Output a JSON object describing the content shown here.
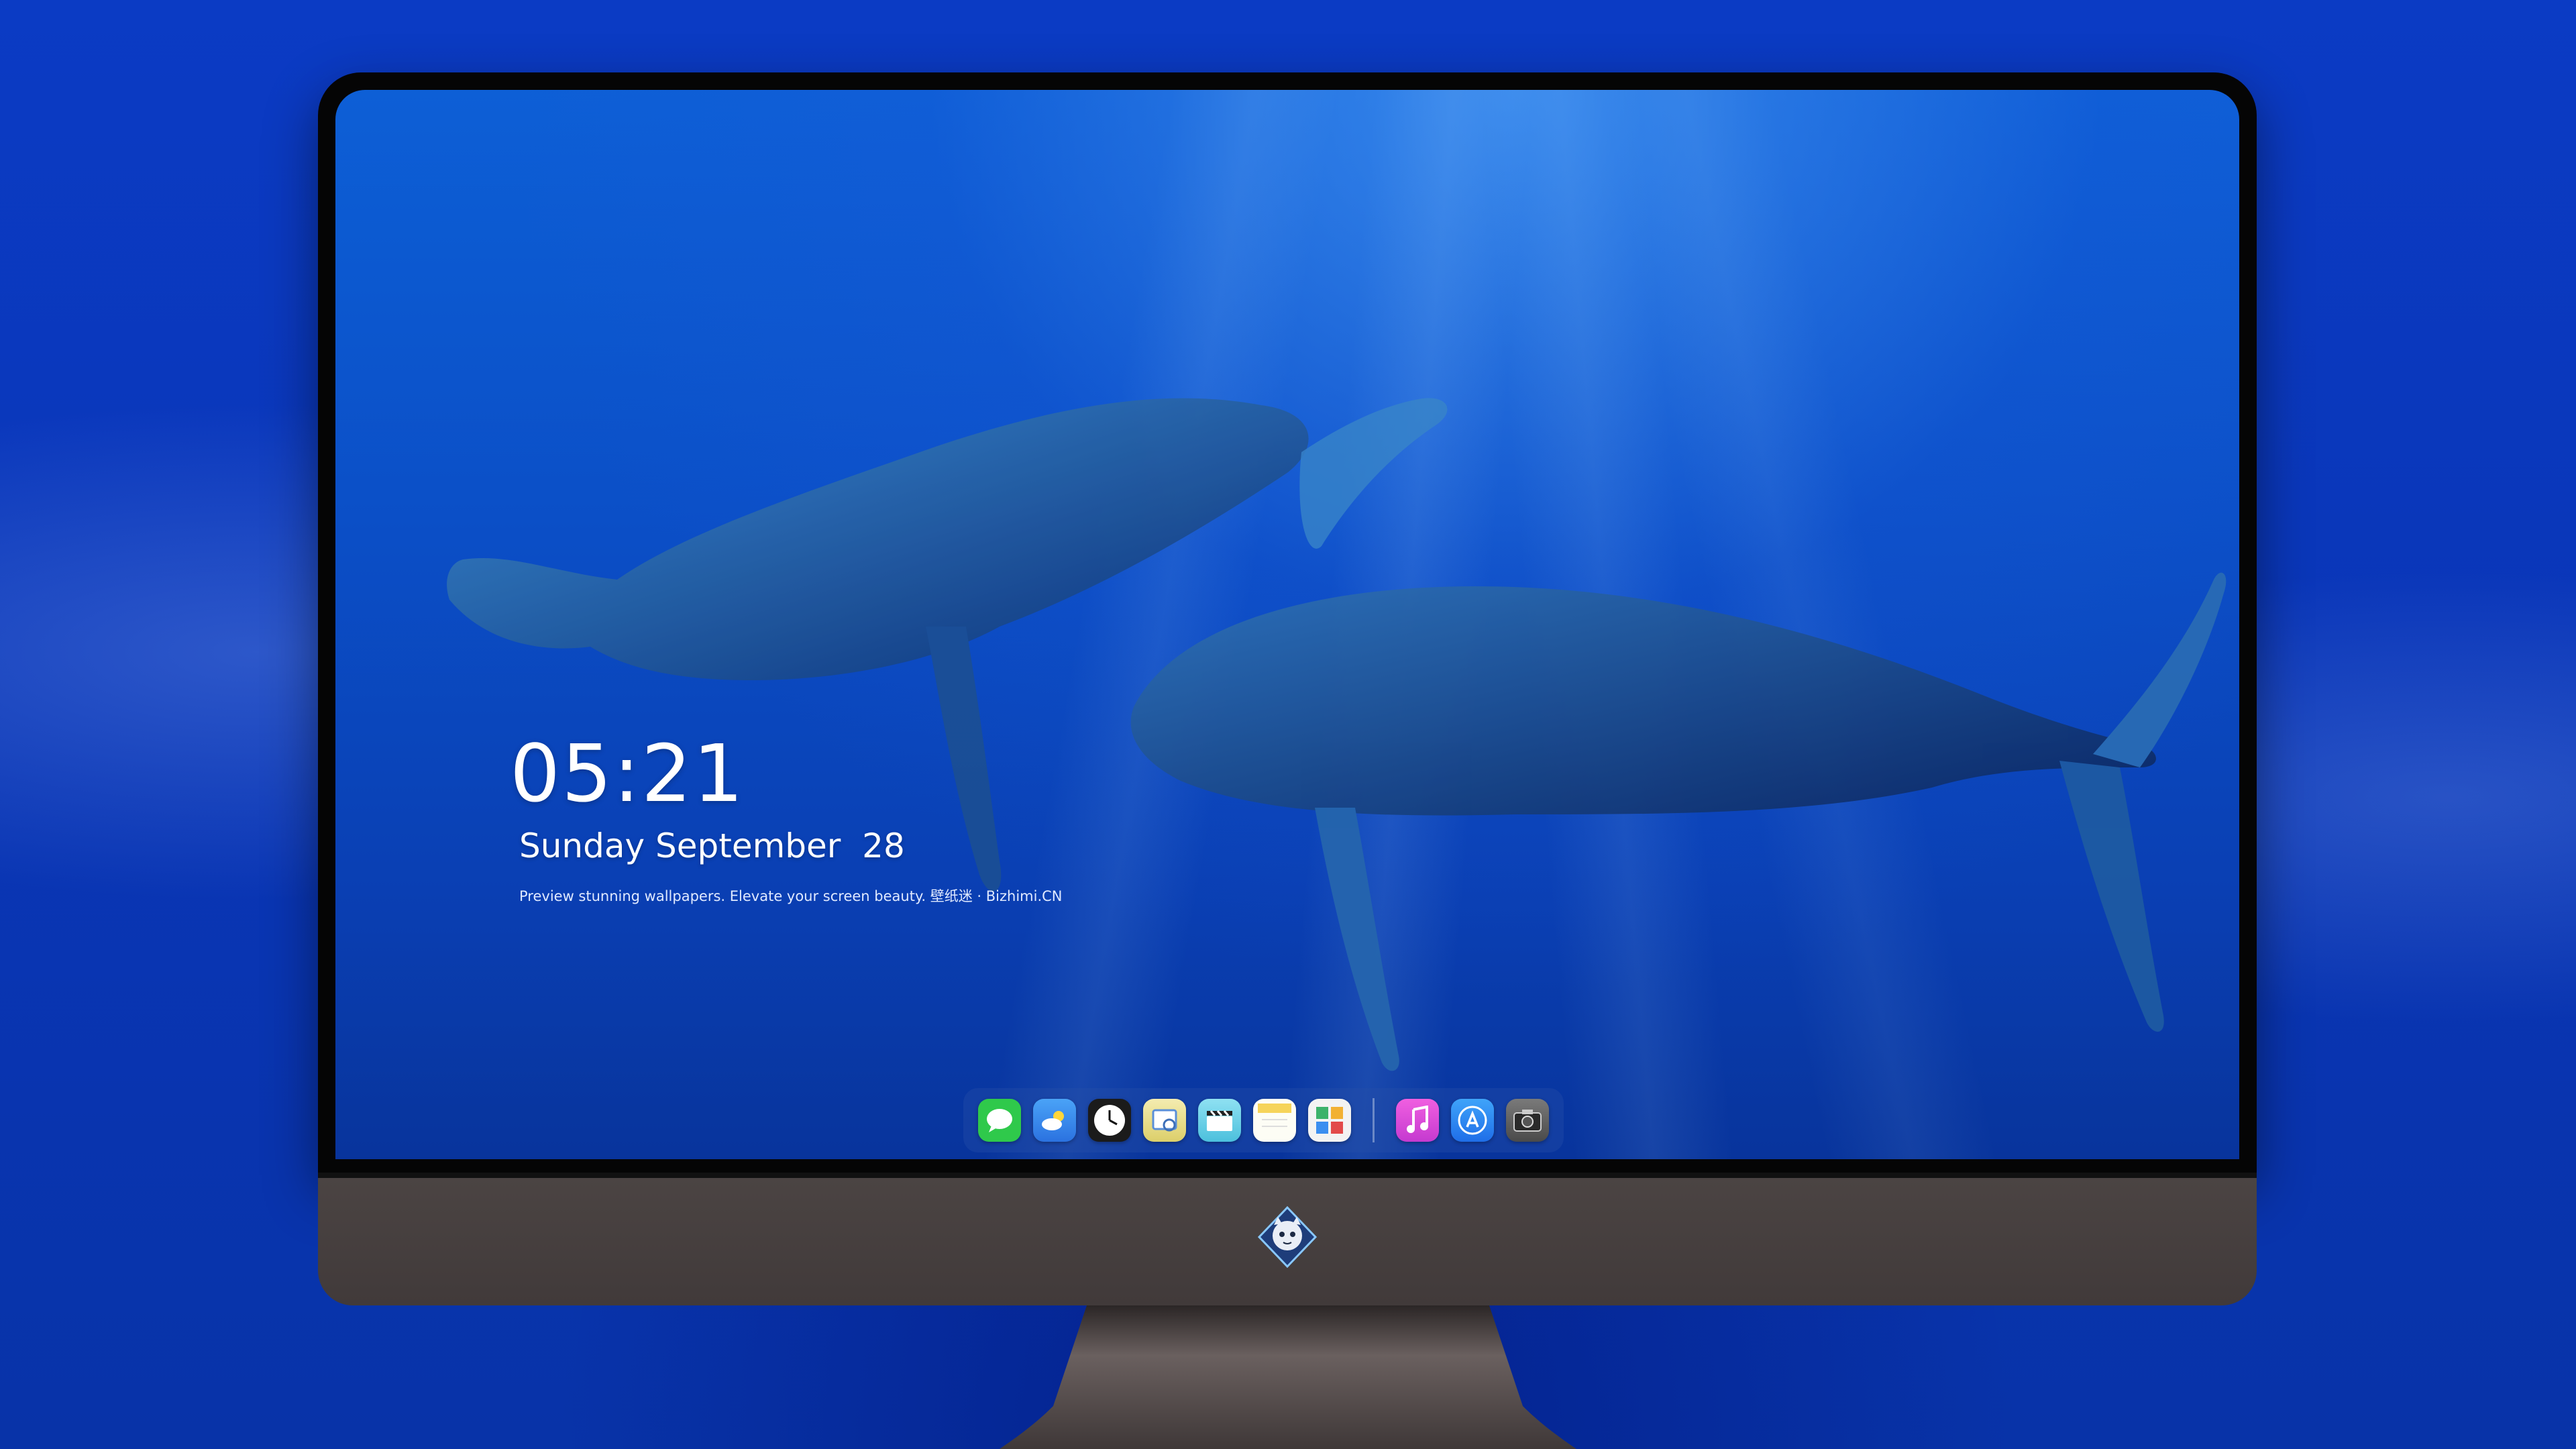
{
  "lock_screen": {
    "time": "05:21",
    "date": "Sunday September  28",
    "tagline": "Preview stunning wallpapers. Elevate your screen beauty. 壁纸迷 · Bizhimi.CN"
  },
  "dock": {
    "apps": [
      {
        "name": "messages",
        "icon": "speech-bubble",
        "color": "#2fc94b"
      },
      {
        "name": "weather",
        "icon": "cloud-sun",
        "color": "#3a8ef0"
      },
      {
        "name": "clock",
        "icon": "clock-face",
        "color": "#1b1b1b"
      },
      {
        "name": "preview",
        "icon": "photo-viewer",
        "color": "#eadf8a"
      },
      {
        "name": "clips",
        "icon": "clapperboard",
        "color": "#6fd2e8"
      },
      {
        "name": "notes",
        "icon": "notepad",
        "color": "#f6d45a"
      },
      {
        "name": "photo-booth",
        "icon": "photo-grid",
        "color": "#3cb26b"
      },
      {
        "name": "music",
        "icon": "music-note",
        "color": "#e24ad6"
      },
      {
        "name": "app-store",
        "icon": "app-store-a",
        "color": "#2b8af3"
      },
      {
        "name": "camera",
        "icon": "camera",
        "color": "#555555"
      }
    ]
  },
  "colors": {
    "background": "#0a36b8",
    "screen": "#0b4fc7",
    "chin": "#4b4443",
    "bezel": "#050505"
  }
}
